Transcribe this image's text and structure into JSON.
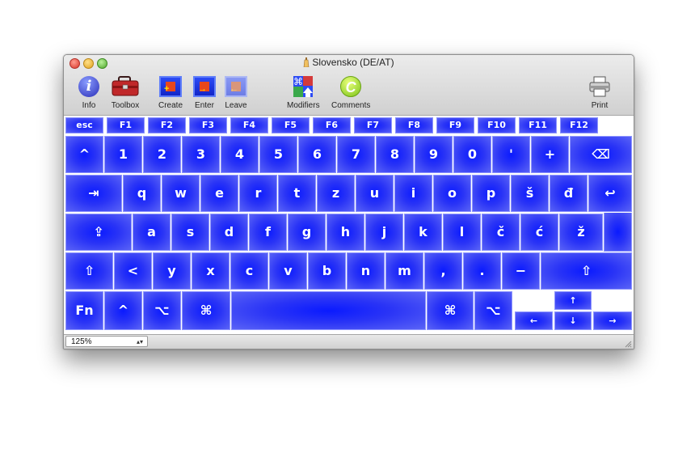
{
  "window": {
    "title": "Slovensko (DE/AT)"
  },
  "toolbar": {
    "info": "Info",
    "toolbox": "Toolbox",
    "create": "Create",
    "enter": "Enter",
    "leave": "Leave",
    "modifiers": "Modifiers",
    "comments": "Comments",
    "print": "Print",
    "info_glyph": "i",
    "comments_glyph": "C",
    "modifiers_glyph": "⌘"
  },
  "colors": {
    "key_center": "#0a1aff",
    "key_edge": "#5a63f6",
    "key_border": "#8e95ff"
  },
  "keyboard": {
    "function_row": [
      "esc",
      "F1",
      "F2",
      "F3",
      "F4",
      "F5",
      "F6",
      "F7",
      "F8",
      "F9",
      "F10",
      "F11",
      "F12"
    ],
    "number_row": [
      "^",
      "1",
      "2",
      "3",
      "4",
      "5",
      "6",
      "7",
      "8",
      "9",
      "0",
      "'",
      "+",
      "⌫"
    ],
    "top_row": [
      "⇥",
      "q",
      "w",
      "e",
      "r",
      "t",
      "z",
      "u",
      "i",
      "o",
      "p",
      "š",
      "đ",
      "↩"
    ],
    "home_row": [
      "⇪",
      "a",
      "s",
      "d",
      "f",
      "g",
      "h",
      "j",
      "k",
      "l",
      "č",
      "ć",
      "ž"
    ],
    "bottom_row": [
      "⇧",
      "<",
      "y",
      "x",
      "c",
      "v",
      "b",
      "n",
      "m",
      ",",
      ".",
      "−",
      "⇧"
    ],
    "modifier_row": [
      "Fn",
      "^",
      "⌥",
      "⌘",
      "",
      "⌘",
      "⌥"
    ],
    "arrows": {
      "up": "↑",
      "left": "←",
      "down": "↓",
      "right": "→"
    }
  },
  "statusbar": {
    "zoom": "125%"
  }
}
